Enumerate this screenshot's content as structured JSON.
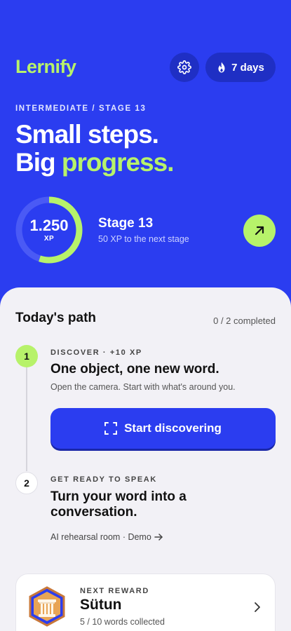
{
  "app": {
    "logo": "Lernify"
  },
  "header": {
    "settings_icon": "gear-icon",
    "streak": {
      "icon": "flame-icon",
      "label": "7 days"
    }
  },
  "hero": {
    "eyebrow": "INTERMEDIATE / STAGE 13",
    "headline_line1": "Small steps.",
    "headline_line2_plain": "Big ",
    "headline_line2_accent": "progress."
  },
  "xp": {
    "value": "1.250",
    "unit": "XP",
    "ring_progress": 0.55,
    "stage_title": "Stage 13",
    "stage_subtitle": "50 XP to the next stage",
    "arrow_icon": "arrow-up-right-icon"
  },
  "path": {
    "title": "Today's path",
    "count": "0 / 2 completed",
    "steps": [
      {
        "number": "1",
        "label": "DISCOVER · +10 XP",
        "title": "One object, one new word.",
        "description": "Open the camera. Start with what's around you.",
        "cta": "Start discovering",
        "cta_icon": "scan-frame-icon"
      },
      {
        "number": "2",
        "label": "GET READY TO SPEAK",
        "title_line1": "Turn your word into a",
        "title_line2": "conversation.",
        "link": "AI rehearsal room · Demo",
        "link_icon": "arrow-right-icon"
      }
    ]
  },
  "reward": {
    "label": "NEXT REWARD",
    "title": "Sütun",
    "progress": "5 / 10 words collected",
    "badge_icon": "column-badge-icon",
    "chevron_icon": "chevron-right-icon"
  },
  "colors": {
    "primary": "#2b3df0",
    "accent": "#b7f26a",
    "sheet": "#f2f1f6"
  }
}
